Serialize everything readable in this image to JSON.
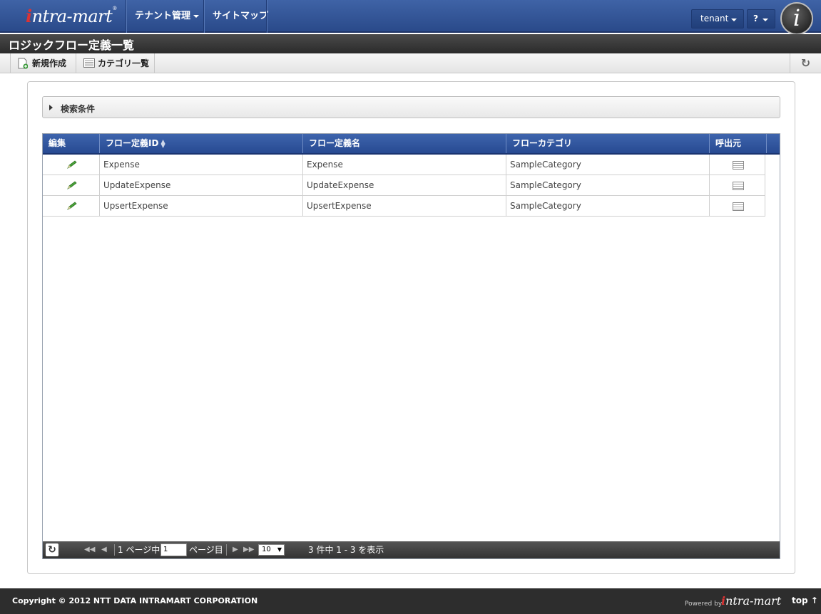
{
  "header": {
    "logo_text": "intra-mart",
    "nav": [
      {
        "label": "テナント管理"
      },
      {
        "label": "サイトマップ"
      }
    ],
    "user_menu": "tenant",
    "help_menu": "?"
  },
  "page": {
    "title": "ロジックフロー定義一覧"
  },
  "toolbar": {
    "new_label": "新規作成",
    "category_label": "カテゴリ一覧"
  },
  "search": {
    "label": "検索条件"
  },
  "table": {
    "columns": [
      "編集",
      "フロー定義ID",
      "フロー定義名",
      "フローカテゴリ",
      "呼出元"
    ],
    "rows": [
      {
        "id": "Expense",
        "name": "Expense",
        "category": "SampleCategory"
      },
      {
        "id": "UpdateExpense",
        "name": "UpdateExpense",
        "category": "SampleCategory"
      },
      {
        "id": "UpsertExpense",
        "name": "UpsertExpense",
        "category": "SampleCategory"
      }
    ]
  },
  "pager": {
    "page_prefix": "1 ページ中",
    "page_value": "1",
    "page_suffix": "ページ目",
    "rows_per_page": "10",
    "summary": "3 件中 1 - 3 を表示"
  },
  "footer": {
    "copyright": "Copyright © 2012 NTT DATA INTRAMART CORPORATION",
    "powered": "Powered by",
    "top_link": "top ↑"
  }
}
